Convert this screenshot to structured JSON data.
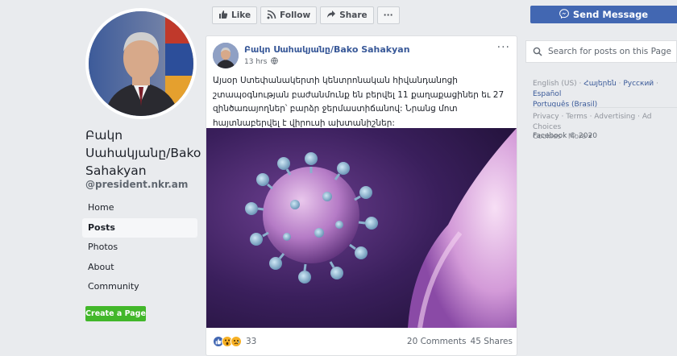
{
  "page": {
    "name": "Բակո Սահակյանը/Bako Sahakyan",
    "handle": "@president.nkr.am"
  },
  "nav": {
    "items": [
      {
        "label": "Home",
        "active": false
      },
      {
        "label": "Posts",
        "active": true
      },
      {
        "label": "Photos",
        "active": false
      },
      {
        "label": "About",
        "active": false
      },
      {
        "label": "Community",
        "active": false
      }
    ],
    "create_page": "Create a Page"
  },
  "actionbar": {
    "like": "Like",
    "follow": "Follow",
    "share": "Share",
    "more": "···"
  },
  "post": {
    "author": "Բակո Սահակյանը/Bako Sahakyan",
    "time": "13 hrs",
    "menu": "···",
    "text": "Այսօր Ստեփանակերտի կենտրոնական հիվանդանոցի շտապօգնության բաժանմունք են բերվել 11 քաղաքացիներ եւ 27 զինծառայողներ՝ բարձր ջերմաստիճանով: Նրանց մոտ հայտնաբերվել է վիրուսի ախտանիշներ:",
    "reaction_count": "33",
    "comments": "20 Comments",
    "shares": "45 Shares",
    "reactions": [
      "like-reaction",
      "wow-reaction",
      "sad-reaction"
    ]
  },
  "right": {
    "send_message": "Send Message",
    "search_placeholder": "Search for posts on this Page",
    "languages": {
      "current": "English (US)",
      "others": [
        "Հայերեն",
        "Русский",
        "Español",
        "Português (Brasil)"
      ]
    },
    "footer_links": [
      "Privacy",
      "Terms",
      "Advertising",
      "Ad Choices",
      "Cookies",
      "More"
    ],
    "copyright": "Facebook © 2020"
  },
  "colors": {
    "fb_blue": "#4267b2",
    "link_blue": "#385898",
    "create_green": "#42b72a",
    "bg": "#e9ebee"
  }
}
